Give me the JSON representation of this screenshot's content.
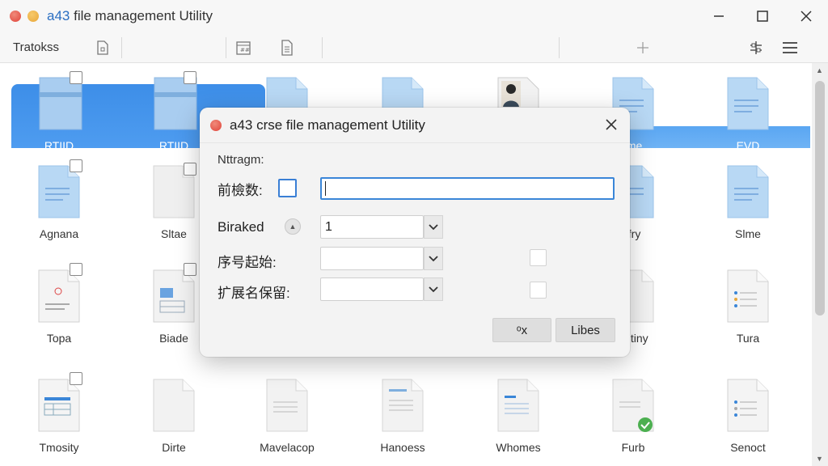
{
  "window": {
    "title_brand": "a43",
    "title_rest": " file management Utility"
  },
  "toolbar": {
    "label": "Tratokss"
  },
  "files": [
    {
      "label": "RTIID",
      "selected": true
    },
    {
      "label": "RTIID",
      "selected": true
    },
    {
      "label": "",
      "selected": false
    },
    {
      "label": "",
      "selected": false
    },
    {
      "label": "",
      "selected": false
    },
    {
      "label": "ime",
      "selected": true
    },
    {
      "label": "EVD",
      "selected": true
    },
    {
      "label": "Agnana"
    },
    {
      "label": "Sltae"
    },
    {
      "label": "lfry"
    },
    {
      "label": "Slme"
    },
    {
      "label": "Topa"
    },
    {
      "label": "Biade"
    },
    {
      "label": "antiny"
    },
    {
      "label": "Tura"
    },
    {
      "label": "Tmosity"
    },
    {
      "label": "Dirte"
    },
    {
      "label": "Mavelacop"
    },
    {
      "label": "Hanoess"
    },
    {
      "label": "Whomes"
    },
    {
      "label": "Furb"
    },
    {
      "label": "Senoct"
    }
  ],
  "dialog": {
    "title": "a43 crse file management Utility",
    "subtitle": "Nttragm:",
    "row1_label": "前檢数:",
    "row1_value": "",
    "row2_label": "Biraked",
    "row2_value": "1",
    "row3_label": "序号起始:",
    "row3_value": "",
    "row4_label": "扩展名保留:",
    "row4_value": "",
    "ok_label": "ᵒx",
    "cancel_label": "Libes"
  },
  "colors": {
    "accent": "#3a86d8",
    "selection": "#4594ec"
  }
}
